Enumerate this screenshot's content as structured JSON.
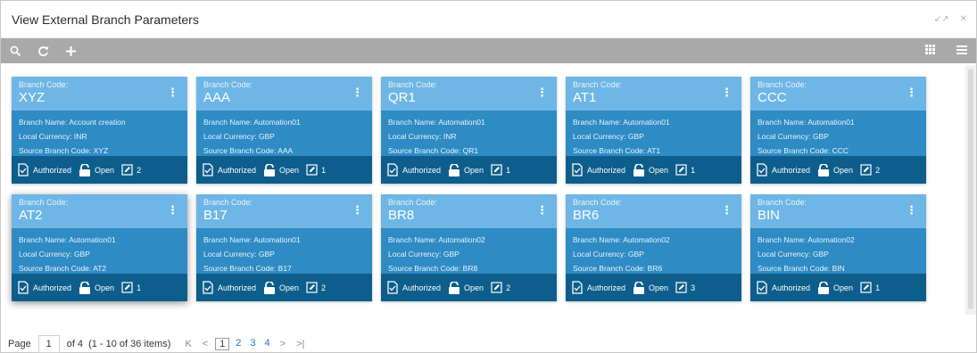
{
  "window": {
    "title": "View External Branch Parameters"
  },
  "labels": {
    "branch_code": "Branch Code:",
    "branch_name": "Branch Name:",
    "local_currency": "Local Currency:",
    "source_branch_code": "Source Branch Code:",
    "authorized": "Authorized",
    "open": "Open"
  },
  "cards": [
    {
      "code": "XYZ",
      "name": "Account creation",
      "currency": "INR",
      "source": "XYZ",
      "count": "2"
    },
    {
      "code": "AAA",
      "name": "Automation01",
      "currency": "GBP",
      "source": "AAA",
      "count": "1"
    },
    {
      "code": "QR1",
      "name": "Automation01",
      "currency": "INR",
      "source": "QR1",
      "count": "1"
    },
    {
      "code": "AT1",
      "name": "Automation01",
      "currency": "GBP",
      "source": "AT1",
      "count": "1"
    },
    {
      "code": "CCC",
      "name": "Automation01",
      "currency": "GBP",
      "source": "CCC",
      "count": "2"
    },
    {
      "code": "AT2",
      "name": "Automation01",
      "currency": "GBP",
      "source": "AT2",
      "count": "1"
    },
    {
      "code": "B17",
      "name": "Automation01",
      "currency": "GBP",
      "source": "B17",
      "count": "2"
    },
    {
      "code": "BR8",
      "name": "Automation02",
      "currency": "GBP",
      "source": "BR8",
      "count": "2"
    },
    {
      "code": "BR6",
      "name": "Automation02",
      "currency": "GBP",
      "source": "BR6",
      "count": "3"
    },
    {
      "code": "BIN",
      "name": "Automation02",
      "currency": "GBP",
      "source": "BIN",
      "count": "1"
    }
  ],
  "pagination": {
    "page_label": "Page",
    "current_page": "1",
    "of_label": "of 4",
    "items_summary": "(1 - 10 of 36 items)",
    "pages": [
      "1",
      "2",
      "3",
      "4"
    ],
    "first_glyph": "K",
    "prev_glyph": "<",
    "next_glyph": ">",
    "last_glyph": ">|"
  }
}
